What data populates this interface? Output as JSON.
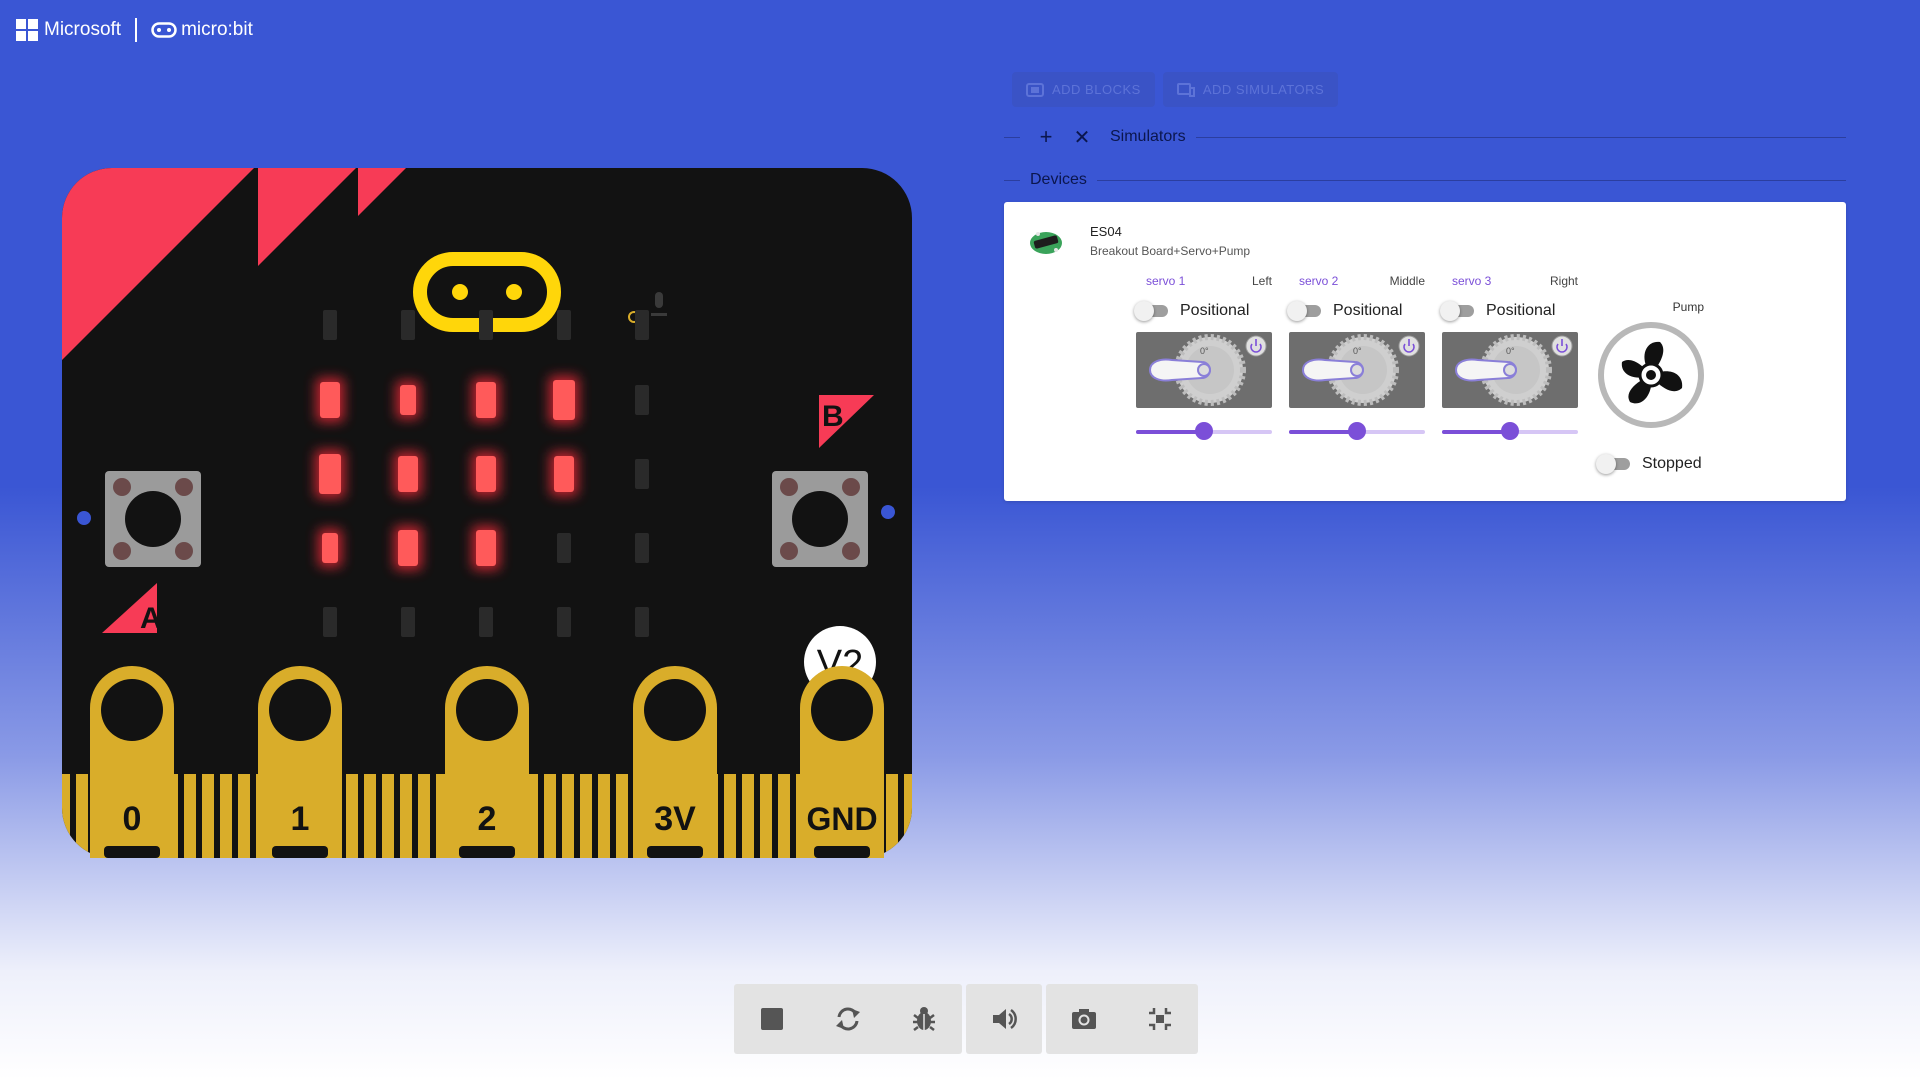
{
  "brand": {
    "microsoft": "Microsoft",
    "microbit": "micro:bit"
  },
  "board": {
    "version": "V2",
    "button_a": "A",
    "button_b": "B",
    "pins": [
      "0",
      "1",
      "2",
      "3V",
      "GND"
    ],
    "led_matrix": [
      [
        0,
        0,
        0,
        0,
        0
      ],
      [
        2,
        1,
        2,
        3,
        0
      ],
      [
        3,
        2,
        2,
        2,
        0
      ],
      [
        1,
        2,
        2,
        0,
        0
      ],
      [
        0,
        0,
        0,
        0,
        0
      ]
    ],
    "colors": {
      "body": "#121212",
      "accent": "#f73b56",
      "gold": "#d9ad2a",
      "logo": "#ffd60a",
      "led_on": "#ff5a5a"
    }
  },
  "toolbar": {
    "add_blocks": "ADD BLOCKS",
    "add_simulators": "ADD SIMULATORS"
  },
  "simulators_label": "Simulators",
  "devices_label": "Devices",
  "device": {
    "name": "ES04",
    "description": "Breakout Board+Servo+Pump",
    "servos": [
      {
        "title": "servo 1",
        "position": "Left",
        "mode": "Positional",
        "value": 0.5
      },
      {
        "title": "servo 2",
        "position": "Middle",
        "mode": "Positional",
        "value": 0.5
      },
      {
        "title": "servo 3",
        "position": "Right",
        "mode": "Positional",
        "value": 0.5
      }
    ],
    "pump": {
      "label": "Pump",
      "state": "Stopped"
    }
  },
  "bottom_controls": [
    "stop",
    "restart",
    "debug",
    "sound",
    "screenshot",
    "fullscreen"
  ],
  "theme": {
    "background": "#3a56d4",
    "accent": "#7b4fd8"
  }
}
